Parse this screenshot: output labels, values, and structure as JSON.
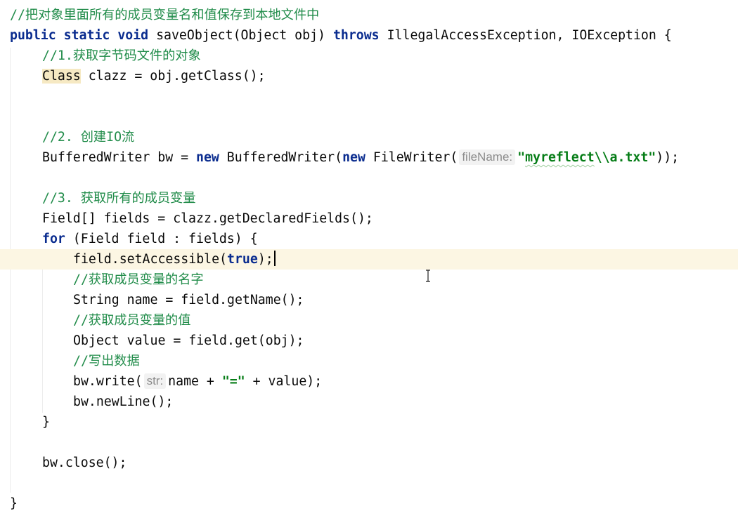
{
  "editor": {
    "language": "Java",
    "lines": {
      "l1_comment": "//把对象里面所有的成员变量名和值保存到本地文件中",
      "l2_kw_public": "public",
      "l2_kw_static": "static",
      "l2_kw_void": "void",
      "l2_sig": "saveObject(Object obj)",
      "l2_kw_throws": "throws",
      "l2_exc": "IllegalAccessException, IOException {",
      "l3_comment": "//1.获取字节码文件的对象",
      "l4_class": "Class",
      "l4_rest": " clazz = obj.getClass();",
      "l5_comment": "//2. 创建IO流",
      "l6_a": "BufferedWriter bw = ",
      "l6_kw_new1": "new",
      "l6_b": " BufferedWriter(",
      "l6_kw_new2": "new",
      "l6_c": " FileWriter(",
      "l6_hint": "fileName:",
      "l6_str_open": "\"",
      "l6_str_word": "myreflect",
      "l6_str_close": "\\\\a.txt\"",
      "l6_end": "));",
      "l7_comment": "//3. 获取所有的成员变量",
      "l8": "Field[] fields = clazz.getDeclaredFields();",
      "l9_kw_for": "for",
      "l9_rest": " (Field field : fields) {",
      "l10_a": "field.setAccessible(",
      "l10_kw_true": "true",
      "l10_b": ");",
      "l11_comment": "//获取成员变量的名字",
      "l12": "String name = field.getName();",
      "l13_comment": "//获取成员变量的值",
      "l14": "Object value = field.get(obj);",
      "l15_comment": "//写出数据",
      "l16_a": "bw.write(",
      "l16_hint": "str:",
      "l16_b": "name + ",
      "l16_str": "\"=\"",
      "l16_c": " + value);",
      "l17": "bw.newLine();",
      "l18": "}",
      "l19": "bw.close();",
      "l20": "}"
    }
  },
  "colors": {
    "keyword": "#0a2c8f",
    "comment": "#218c4a",
    "string": "#067d17",
    "current_line": "#fcf6e3",
    "hint_bg": "#f2f2f2"
  },
  "cursor": {
    "icon": "i-beam-cursor-icon"
  }
}
